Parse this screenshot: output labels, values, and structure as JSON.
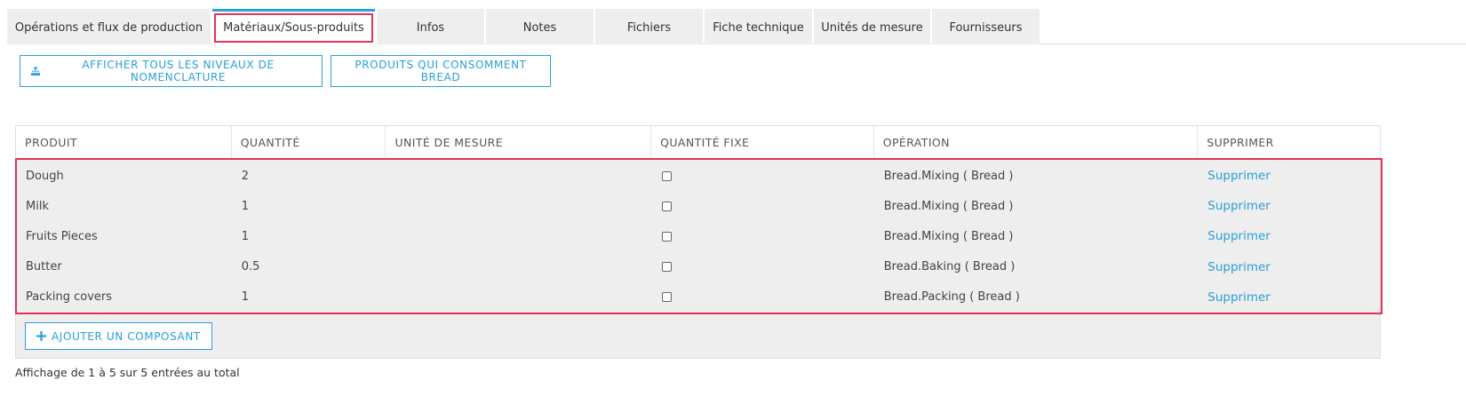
{
  "tabs": [
    {
      "label": "Opérations et flux de production",
      "active": false
    },
    {
      "label": "Matériaux/Sous-produits",
      "active": true
    },
    {
      "label": "Infos",
      "active": false
    },
    {
      "label": "Notes",
      "active": false
    },
    {
      "label": "Fichiers",
      "active": false
    },
    {
      "label": "Fiche technique",
      "active": false
    },
    {
      "label": "Unités de mesure",
      "active": false
    },
    {
      "label": "Fournisseurs",
      "active": false
    }
  ],
  "actions": {
    "show_all_levels": "AFFICHER TOUS LES NIVEAUX DE NOMENCLATURE",
    "consuming_products": "PRODUITS QUI CONSOMMENT BREAD"
  },
  "table": {
    "headers": [
      "PRODUIT",
      "QUANTITÉ",
      "UNITÉ DE MESURE",
      "QUANTITÉ FIXE",
      "OPÉRATION",
      "SUPPRIMER"
    ],
    "rows": [
      {
        "product": "Dough",
        "quantity": "2",
        "unit": "",
        "fixed": false,
        "operation": "Bread.Mixing ( Bread )",
        "delete": "Supprimer"
      },
      {
        "product": "Milk",
        "quantity": "1",
        "unit": "",
        "fixed": false,
        "operation": "Bread.Mixing ( Bread )",
        "delete": "Supprimer"
      },
      {
        "product": "Fruits Pieces",
        "quantity": "1",
        "unit": "",
        "fixed": false,
        "operation": "Bread.Mixing ( Bread )",
        "delete": "Supprimer"
      },
      {
        "product": "Butter",
        "quantity": "0.5",
        "unit": "",
        "fixed": false,
        "operation": "Bread.Baking ( Bread )",
        "delete": "Supprimer"
      },
      {
        "product": "Packing covers",
        "quantity": "1",
        "unit": "",
        "fixed": false,
        "operation": "Bread.Packing ( Bread )",
        "delete": "Supprimer"
      }
    ],
    "add_component": "AJOUTER UN COMPOSANT"
  },
  "footer": {
    "summary": "Affichage de 1 à 5 sur 5 entrées au total"
  },
  "colors": {
    "accent": "#2a9fd8",
    "highlight": "#e0335a",
    "row_bg": "#eeeeee"
  }
}
